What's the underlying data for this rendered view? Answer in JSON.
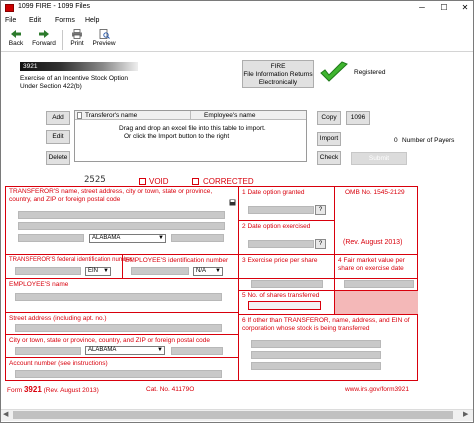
{
  "window": {
    "title": "1099 FIRE - 1099 Files",
    "minimize": "─",
    "maximize": "☐",
    "close": "✕"
  },
  "menu": [
    "File",
    "Edit",
    "Forms",
    "Help"
  ],
  "toolbar": {
    "back": "Back",
    "forward": "Forward",
    "print": "Print",
    "preview": "Preview"
  },
  "form_header": {
    "form_number": "3921",
    "title_line1": "Exercise of an Incentive Stock Option",
    "title_line2": "Under Section 422(b)"
  },
  "fire_box": {
    "line1": "FIRE",
    "line2": "File Information Returns",
    "line3": "Electronically"
  },
  "registered": "Registered",
  "left_buttons": {
    "add": "Add",
    "edit": "Edit",
    "delete": "Delete"
  },
  "table": {
    "col1": "Transferor's name",
    "col2": "Employee's name",
    "hint1": "Drag and drop an excel file into this table to import.",
    "hint2": "Or click the Import button to the right"
  },
  "right_buttons": {
    "copy": "Copy",
    "form1096": "1096",
    "import": "Import",
    "check": "Check",
    "submit": "Submit Electronically"
  },
  "payers": {
    "count": "0",
    "label": "Number of Payers"
  },
  "top_row": {
    "code": "2525",
    "void": "VOID",
    "corrected": "CORRECTED"
  },
  "box_transferor": {
    "label": "TRANSFEROR'S name, street address, city or town, state or province, country, and ZIP or foreign postal code",
    "state": "ALABAMA"
  },
  "box1": {
    "num": "1",
    "label": "Date option granted",
    "q": "?"
  },
  "box2": {
    "num": "2",
    "label": "Date option exercised",
    "q": "?"
  },
  "omb": {
    "text": "OMB No. 1545-2129",
    "rev": "(Rev. August 2013)"
  },
  "fed_id": {
    "label": "TRANSFEROR'S federal identification number",
    "type": "EIN"
  },
  "emp_id": {
    "label": "EMPLOYEE'S identification number",
    "type": "N/A"
  },
  "box3": {
    "num": "3",
    "label": "Exercise price per share"
  },
  "box4": {
    "num": "4",
    "label": "Fair market value per share on exercise date"
  },
  "emp_name": {
    "label": "EMPLOYEE'S name"
  },
  "box5": {
    "num": "5",
    "label": "No. of shares transferred"
  },
  "box6": {
    "num": "6",
    "label": "If other than TRANSFEROR, name, address, and EIN of corporation whose stock is being transferred"
  },
  "street": {
    "label": "Street address (including apt. no.)"
  },
  "city": {
    "label": "City or town, state or province, country, and ZIP or foreign postal code",
    "state": "ALABAMA"
  },
  "account": {
    "label": "Account number (see instructions)"
  },
  "footer": {
    "form_prefix": "Form",
    "form_num": "3921",
    "rev": "(Rev. August 2013)",
    "cat": "Cat. No. 41179O",
    "url": "www.irs.gov/form3921"
  },
  "colors": {
    "form_red": "#d8000c",
    "field_gray": "#c9c9c9"
  }
}
